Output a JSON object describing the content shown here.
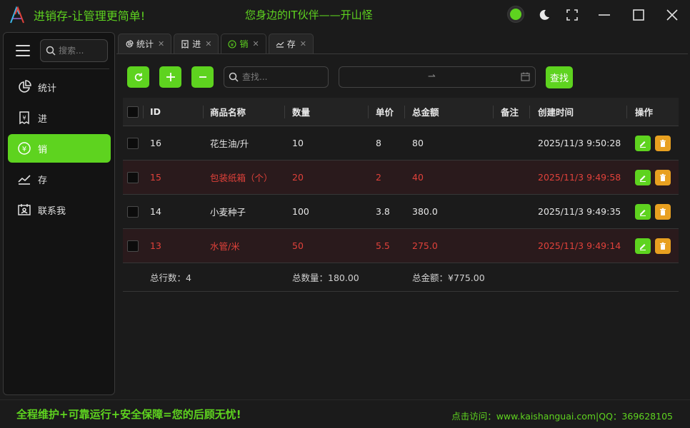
{
  "window": {
    "title": "进销存-让管理更简单!",
    "slogan": "您身边的IT伙伴——开山怪"
  },
  "sidebar": {
    "search_placeholder": "搜索...",
    "items": [
      {
        "label": "统计",
        "icon": "pie-chart-icon"
      },
      {
        "label": "进",
        "icon": "receipt-icon"
      },
      {
        "label": "销",
        "icon": "yen-circle-icon",
        "active": true
      },
      {
        "label": "存",
        "icon": "trend-line-icon"
      },
      {
        "label": "联系我",
        "icon": "contact-card-icon"
      }
    ]
  },
  "tabs": [
    {
      "label": "统计",
      "icon": "pie-chart-icon"
    },
    {
      "label": "进",
      "icon": "receipt-icon"
    },
    {
      "label": "销",
      "icon": "yen-circle-icon",
      "active": true
    },
    {
      "label": "存",
      "icon": "trend-line-icon"
    }
  ],
  "toolbar": {
    "search_placeholder": "查找...",
    "date_separator": "⇀",
    "find_label": "查找"
  },
  "table": {
    "headers": {
      "id": "ID",
      "name": "商品名称",
      "qty": "数量",
      "price": "单价",
      "total": "总金额",
      "note": "备注",
      "created": "创建时间",
      "actions": "操作"
    },
    "rows": [
      {
        "id": "16",
        "name": "花生油/升",
        "qty": "10",
        "price": "8",
        "total": "80",
        "note": "",
        "created": "2025/11/3 9:50:28",
        "highlight": false
      },
      {
        "id": "15",
        "name": "包装纸箱（个）",
        "qty": "20",
        "price": "2",
        "total": "40",
        "note": "",
        "created": "2025/11/3 9:49:58",
        "highlight": true
      },
      {
        "id": "14",
        "name": "小麦种子",
        "qty": "100",
        "price": "3.8",
        "total": "380.0",
        "note": "",
        "created": "2025/11/3 9:49:35",
        "highlight": false
      },
      {
        "id": "13",
        "name": "水管/米",
        "qty": "50",
        "price": "5.5",
        "total": "275.0",
        "note": "",
        "created": "2025/11/3 9:49:14",
        "highlight": true
      }
    ],
    "summary": {
      "rows": "总行数：4",
      "qty": "总数量：180.00",
      "total": "总金额：¥775.00"
    }
  },
  "footer": {
    "left": "全程维护+可靠运行+安全保障=您的后顾无忧!",
    "right": "点击访问：www.kaishanguai.com|QQ：369628105"
  },
  "colors": {
    "accent": "#5ed31f",
    "alert_text": "#e0413a",
    "alert_row": "#2a1a1c",
    "delete": "#e8a020"
  }
}
